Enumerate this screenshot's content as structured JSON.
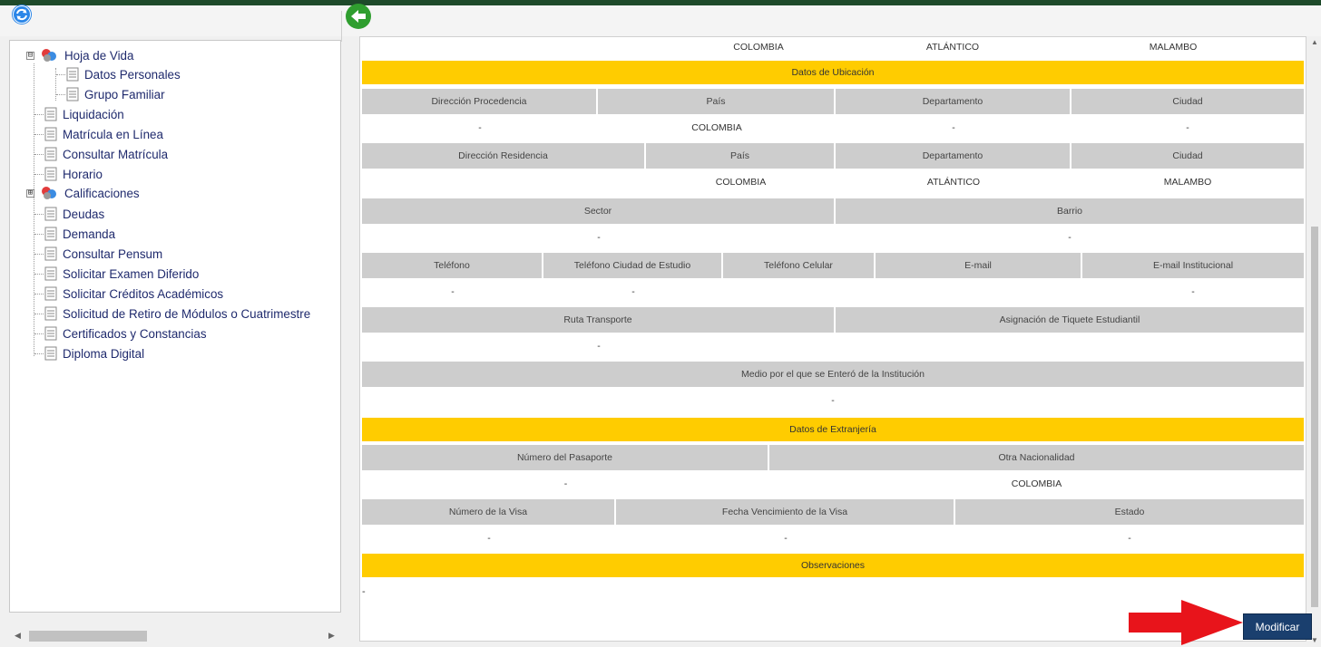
{
  "nav_tree": {
    "root": {
      "label": "Hoja de Vida",
      "expander": "⊟",
      "children": [
        "Datos Personales",
        "Grupo Familiar"
      ]
    },
    "items_a": [
      "Liquidación",
      "Matrícula en Línea",
      "Consultar Matrícula",
      "Horario"
    ],
    "group_b": {
      "label": "Calificaciones",
      "expander": "⊞"
    },
    "items_b": [
      "Deudas",
      "Demanda",
      "Consultar Pensum",
      "Solicitar Examen Diferido",
      "Solicitar Créditos Académicos",
      "Solicitud de Retiro de Módulos o Cuatrimestre",
      "Certificados y Constancias",
      "Diploma Digital"
    ]
  },
  "form": {
    "top_values": [
      "COLOMBIA",
      "ATLÁNTICO",
      "MALAMBO"
    ],
    "ubicacion": {
      "title": "Datos de Ubicación",
      "procedencia_headers": [
        "Dirección Procedencia",
        "País",
        "Departamento",
        "Ciudad"
      ],
      "procedencia_values": [
        "-",
        "COLOMBIA",
        "-",
        "-"
      ],
      "residencia_headers": [
        "Dirección Residencia",
        "País",
        "Departamento",
        "Ciudad"
      ],
      "residencia_values": [
        "",
        "COLOMBIA",
        "ATLÁNTICO",
        "MALAMBO"
      ],
      "sector_headers": [
        "Sector",
        "Barrio"
      ],
      "sector_values": [
        "-",
        "-"
      ],
      "contact_headers": [
        "Teléfono",
        "Teléfono Ciudad de Estudio",
        "Teléfono Celular",
        "E-mail",
        "E-mail Institucional"
      ],
      "contact_values": [
        "-",
        "-",
        "",
        "",
        "-"
      ],
      "transport_headers": [
        "Ruta Transporte",
        "Asignación de Tiquete Estudiantil"
      ],
      "transport_values": [
        "-",
        ""
      ],
      "medio_header": "Medio por el que se Enteró de la Institución",
      "medio_value": "-"
    },
    "extranjeria": {
      "title": "Datos de Extranjería",
      "pasaporte_headers": [
        "Número del Pasaporte",
        "Otra Nacionalidad"
      ],
      "pasaporte_values": [
        "-",
        "COLOMBIA"
      ],
      "visa_headers": [
        "Número de la Visa",
        "Fecha Vencimiento de la Visa",
        "Estado"
      ],
      "visa_values": [
        "-",
        "-",
        "-"
      ]
    },
    "observaciones": {
      "title": "Observaciones",
      "value": "-"
    }
  },
  "modify_button": "Modificar",
  "colors": {
    "section": "#ffcc00",
    "header_cell": "#cdcdcd",
    "button": "#1a3f6e",
    "arrow": "#e8141b",
    "topbar": "#1e4a2a"
  },
  "icons": [
    "refresh-icon",
    "back-arrow-icon",
    "document-icon",
    "folder-icon",
    "pointer-arrow"
  ]
}
